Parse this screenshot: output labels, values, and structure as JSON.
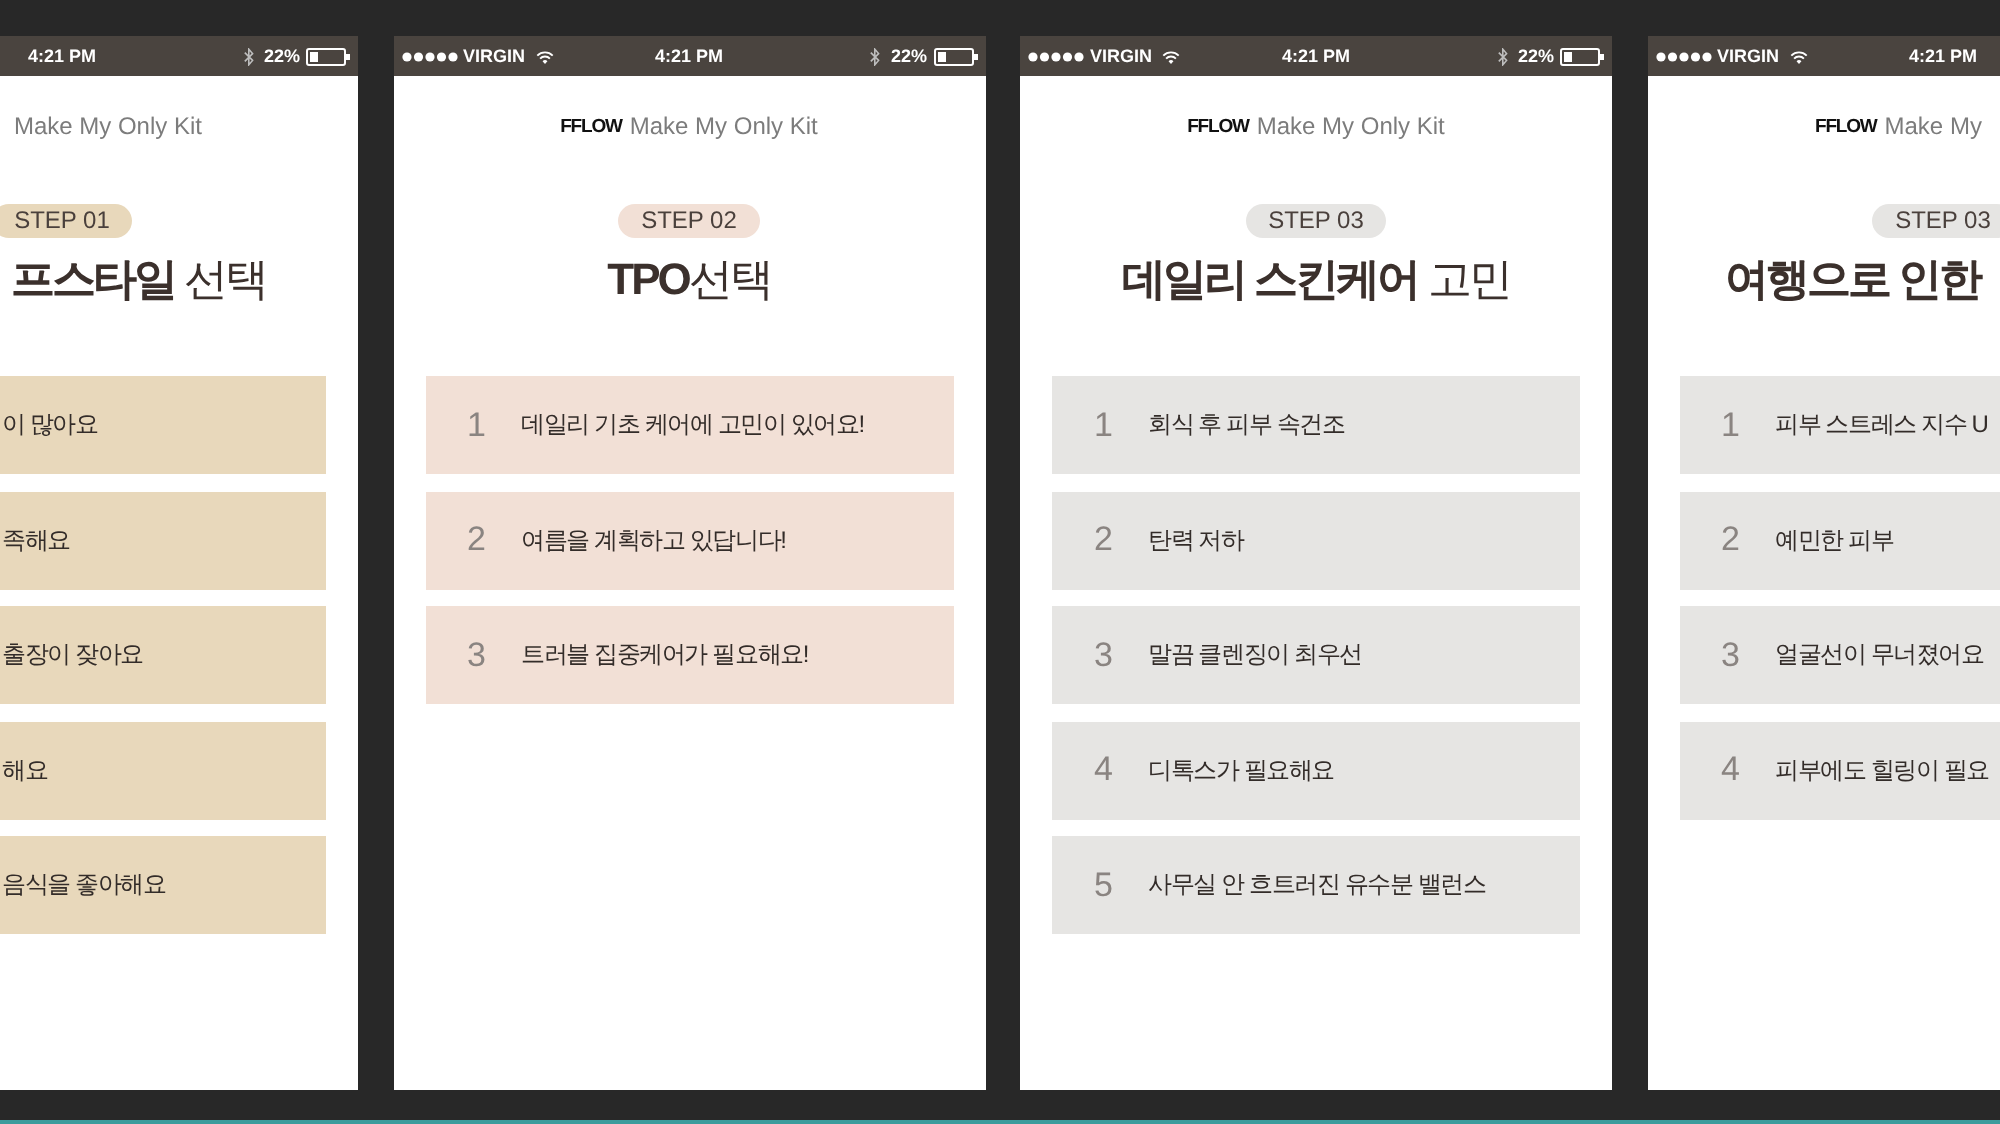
{
  "phones": [
    {
      "color": "#e8d8bb",
      "status_bar": {
        "time": "4:21 PM",
        "battery": "22%"
      },
      "brand": {
        "tagline": "Make My Only Kit"
      },
      "step": "STEP 01",
      "title": "**프스타일** 선택",
      "options": [
        {
          "text": "이 많아요"
        },
        {
          "text": "족해요"
        },
        {
          "text": "출장이 잦아요"
        },
        {
          "text": "해요"
        },
        {
          "text": "음식을 좋아해요"
        }
      ]
    },
    {
      "color": "#f2e0d6",
      "status_bar": {
        "carrier": "VIRGIN",
        "time": "4:21 PM",
        "battery": "22%"
      },
      "brand": {
        "logo": "FFLOW",
        "tagline": "Make My Only Kit"
      },
      "step": "STEP 02",
      "title": "**TPO**선택",
      "options": [
        {
          "number": "1",
          "text": "데일리 기초 케어에 고민이 있어요!"
        },
        {
          "number": "2",
          "text": "여름을 계획하고 있답니다!"
        },
        {
          "number": "3",
          "text": "트러블 집중케어가 필요해요!"
        }
      ]
    },
    {
      "color": "#e6e5e3",
      "status_bar": {
        "carrier": "VIRGIN",
        "time": "4:21 PM",
        "battery": "22%"
      },
      "brand": {
        "logo": "FFLOW",
        "tagline": "Make My Only Kit"
      },
      "step": "STEP 03",
      "title": "**데일리 스킨케어** 고민",
      "options": [
        {
          "number": "1",
          "text": "회식 후 피부 속건조"
        },
        {
          "number": "2",
          "text": "탄력 저하"
        },
        {
          "number": "3",
          "text": "말끔 클렌징이 최우선"
        },
        {
          "number": "4",
          "text": "디톡스가 필요해요"
        },
        {
          "number": "5",
          "text": "사무실 안 흐트러진 유수분 밸런스"
        }
      ]
    },
    {
      "color": "#e6e5e3",
      "status_bar": {
        "carrier": "VIRGIN",
        "time": "4:21 PM"
      },
      "brand": {
        "logo": "FFLOW",
        "tagline": "Make My"
      },
      "step": "STEP 03",
      "title": "**여행으로 인한**",
      "options": [
        {
          "number": "1",
          "text": "피부 스트레스 지수 U"
        },
        {
          "number": "2",
          "text": "예민한 피부"
        },
        {
          "number": "3",
          "text": "얼굴선이 무너졌어요"
        },
        {
          "number": "4",
          "text": "피부에도 힐링이 필요"
        }
      ]
    }
  ]
}
